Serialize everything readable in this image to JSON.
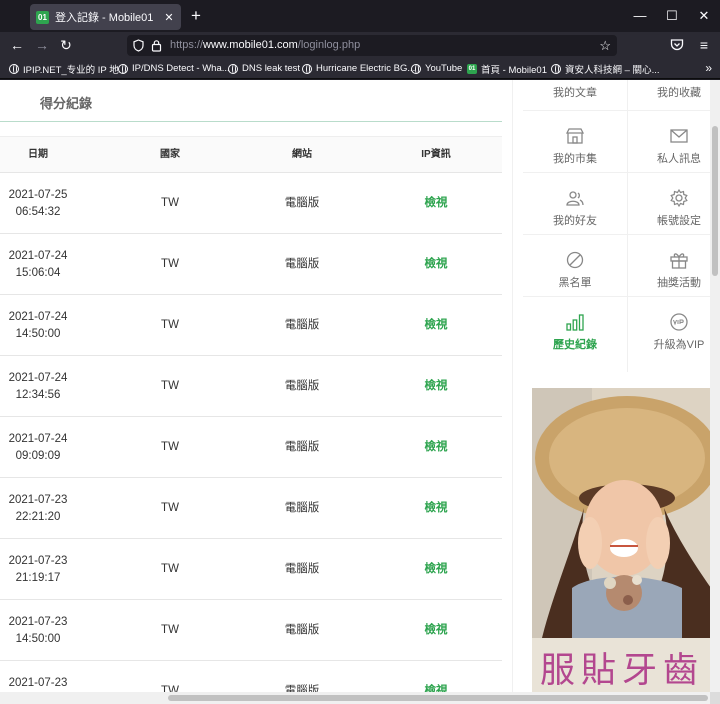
{
  "browser": {
    "tab_title": "登入記錄 - Mobile01",
    "tab_favicon": "01",
    "url": "https://www.mobile01.com/loginlog.php",
    "url_display_host": "www.mobile01.com",
    "bookmarks": [
      {
        "label": "IPIP.NET_专业的 IP 地..."
      },
      {
        "label": "IP/DNS Detect - Wha..."
      },
      {
        "label": "DNS leak test"
      },
      {
        "label": "Hurricane Electric BG..."
      },
      {
        "label": "YouTube"
      },
      {
        "label": "首頁 - Mobile01"
      },
      {
        "label": "資安人科技網 – 關心..."
      }
    ]
  },
  "page": {
    "section_title": "得分紀錄",
    "columns": {
      "date": "日期",
      "country": "國家",
      "site": "網站",
      "ip": "IP資訊"
    },
    "rows": [
      {
        "date": "2021-07-25",
        "time": "06:54:32",
        "country": "TW",
        "site": "電腦版",
        "ip": "檢視"
      },
      {
        "date": "2021-07-24",
        "time": "15:06:04",
        "country": "TW",
        "site": "電腦版",
        "ip": "檢視"
      },
      {
        "date": "2021-07-24",
        "time": "14:50:00",
        "country": "TW",
        "site": "電腦版",
        "ip": "檢視"
      },
      {
        "date": "2021-07-24",
        "time": "12:34:56",
        "country": "TW",
        "site": "電腦版",
        "ip": "檢視"
      },
      {
        "date": "2021-07-24",
        "time": "09:09:09",
        "country": "TW",
        "site": "電腦版",
        "ip": "檢視"
      },
      {
        "date": "2021-07-23",
        "time": "22:21:20",
        "country": "TW",
        "site": "電腦版",
        "ip": "檢視"
      },
      {
        "date": "2021-07-23",
        "time": "21:19:17",
        "country": "TW",
        "site": "電腦版",
        "ip": "檢視"
      },
      {
        "date": "2021-07-23",
        "time": "14:50:00",
        "country": "TW",
        "site": "電腦版",
        "ip": "檢視"
      },
      {
        "date": "2021-07-23",
        "time": "",
        "country": "TW",
        "site": "電腦版",
        "ip": "檢視"
      }
    ]
  },
  "sidebar": {
    "items": [
      {
        "label": "我的文章",
        "icon": "article-icon"
      },
      {
        "label": "我的收藏",
        "icon": "bookmark-icon"
      },
      {
        "label": "我的市集",
        "icon": "store-icon"
      },
      {
        "label": "私人訊息",
        "icon": "mail-icon"
      },
      {
        "label": "我的好友",
        "icon": "friends-icon"
      },
      {
        "label": "帳號設定",
        "icon": "gear-icon"
      },
      {
        "label": "黑名單",
        "icon": "blocked-icon"
      },
      {
        "label": "抽獎活動",
        "icon": "gift-icon"
      },
      {
        "label": "歷史紀錄",
        "icon": "history-chart-icon",
        "active": true
      },
      {
        "label": "升級為VIP",
        "icon": "vip-icon"
      }
    ],
    "ad_text": "服貼牙齒"
  },
  "colors": {
    "accent": "#2ea44f",
    "ad_text": "#b3478f"
  }
}
